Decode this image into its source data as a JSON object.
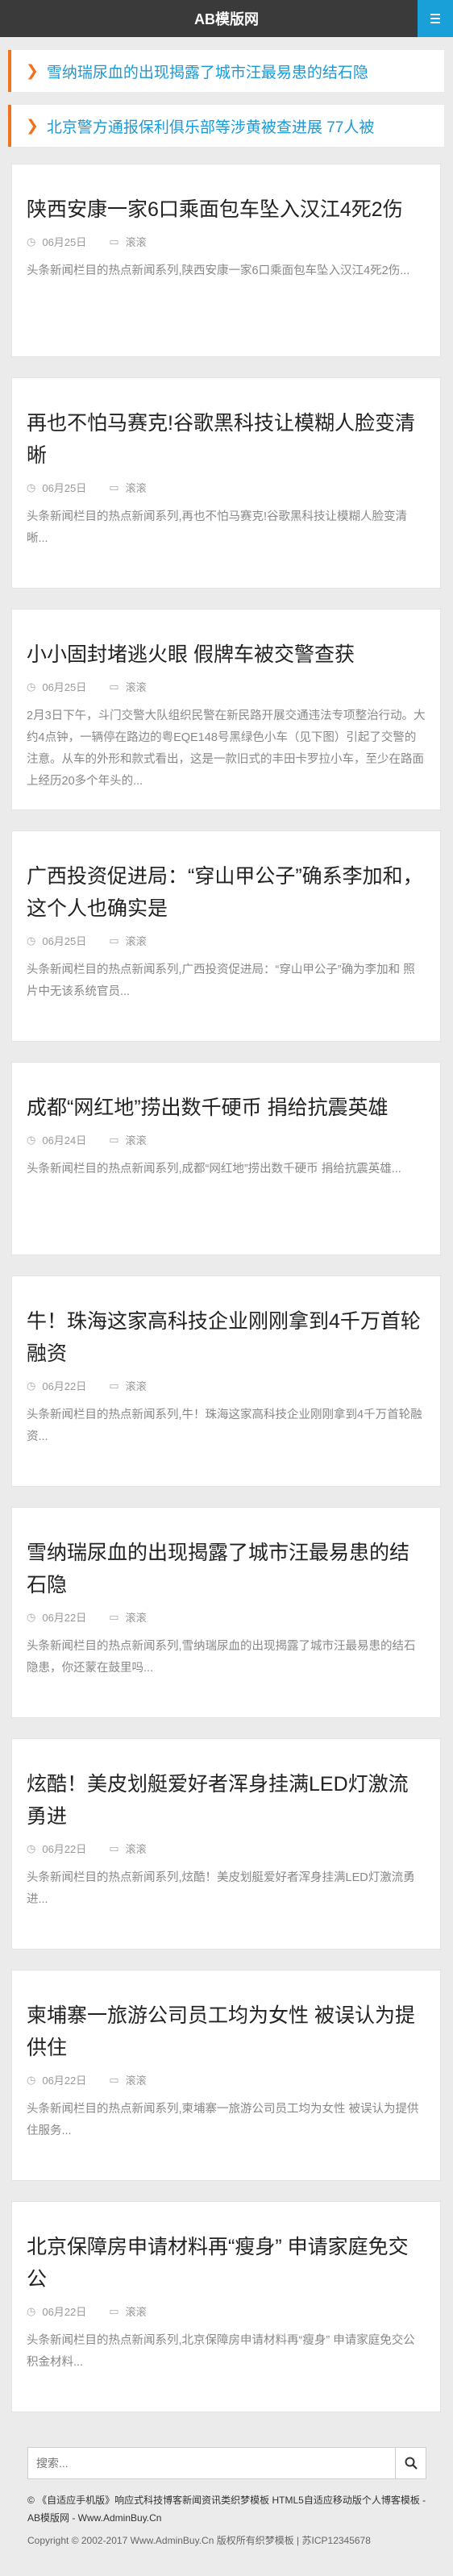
{
  "header": {
    "site_title": "AB模版网"
  },
  "notices": [
    {
      "arrow": "❯",
      "text": "雪纳瑞尿血的出现揭露了城市汪最易患的结石隐"
    },
    {
      "arrow": "❯",
      "text": "北京警方通报保利俱乐部等涉黄被查进展 77人被"
    }
  ],
  "articles": [
    {
      "title": "陕西安康一家6口乘面包车坠入汉江4死2伤",
      "date": "06月25日",
      "category": "滚滚",
      "excerpt": "头条新闻栏目的热点新闻系列,陕西安康一家6口乘面包车坠入汉江4死2伤..."
    },
    {
      "title": "再也不怕马赛克!谷歌黑科技让模糊人脸变清晰",
      "date": "06月25日",
      "category": "滚滚",
      "excerpt": "头条新闻栏目的热点新闻系列,再也不怕马赛克!谷歌黑科技让模糊人脸变清晰..."
    },
    {
      "title": "小小固封堵逃火眼 假牌车被交警查获",
      "date": "06月25日",
      "category": "滚滚",
      "excerpt": "2月3日下午，斗门交警大队组织民警在新民路开展交通违法专项整治行动。大约4点钟，一辆停在路边的粤EQE148号黑绿色小车（见下图）引起了交警的注意。从车的外形和款式看出，这是一款旧式的丰田卡罗拉小车，至少在路面上经历20多个年头的..."
    },
    {
      "title": "广西投资促进局：“穿山甲公子”确系李加和，这个人也确实是",
      "date": "06月25日",
      "category": "滚滚",
      "excerpt": "头条新闻栏目的热点新闻系列,广西投资促进局：“穿山甲公子”确为李加和 照片中无该系统官员..."
    },
    {
      "title": "成都“网红地”捞出数千硬币 捐给抗震英雄",
      "date": "06月24日",
      "category": "滚滚",
      "excerpt": "头条新闻栏目的热点新闻系列,成都“网红地”捞出数千硬币 捐给抗震英雄..."
    },
    {
      "title": "牛！珠海这家高科技企业刚刚拿到4千万首轮融资",
      "date": "06月22日",
      "category": "滚滚",
      "excerpt": "头条新闻栏目的热点新闻系列,牛！珠海这家高科技企业刚刚拿到4千万首轮融资..."
    },
    {
      "title": "雪纳瑞尿血的出现揭露了城市汪最易患的结石隐",
      "date": "06月22日",
      "category": "滚滚",
      "excerpt": "头条新闻栏目的热点新闻系列,雪纳瑞尿血的出现揭露了城市汪最易患的结石隐患，你还蒙在鼓里吗..."
    },
    {
      "title": "炫酷！美皮划艇爱好者浑身挂满LED灯激流勇进",
      "date": "06月22日",
      "category": "滚滚",
      "excerpt": "头条新闻栏目的热点新闻系列,炫酷！美皮划艇爱好者浑身挂满LED灯激流勇进..."
    },
    {
      "title": "柬埔寨一旅游公司员工均为女性 被误认为提供住",
      "date": "06月22日",
      "category": "滚滚",
      "excerpt": "头条新闻栏目的热点新闻系列,柬埔寨一旅游公司员工均为女性 被误认为提供住服务..."
    },
    {
      "title": "北京保障房申请材料再“瘦身” 申请家庭免交公",
      "date": "06月22日",
      "category": "滚滚",
      "excerpt": "头条新闻栏目的热点新闻系列,北京保障房申请材料再“瘦身” 申请家庭免交公积金材料..."
    }
  ],
  "search": {
    "placeholder": "搜索...",
    "button_icon": "search-icon"
  },
  "footer": {
    "links_line": "© 《自适应手机版》响应式科技博客新闻资讯类织梦模板 HTML5自适应移动版个人博客模板 - AB模版网 - Www.AdminBuy.Cn",
    "copyright": "Copyright © 2002-2017 Www.AdminBuy.Cn 版权所有织梦模板 | 苏ICP12345678"
  },
  "colors": {
    "accent": "#1aa0d8",
    "notice_border": "#f0731f",
    "topbar": "#3a3a3a"
  }
}
